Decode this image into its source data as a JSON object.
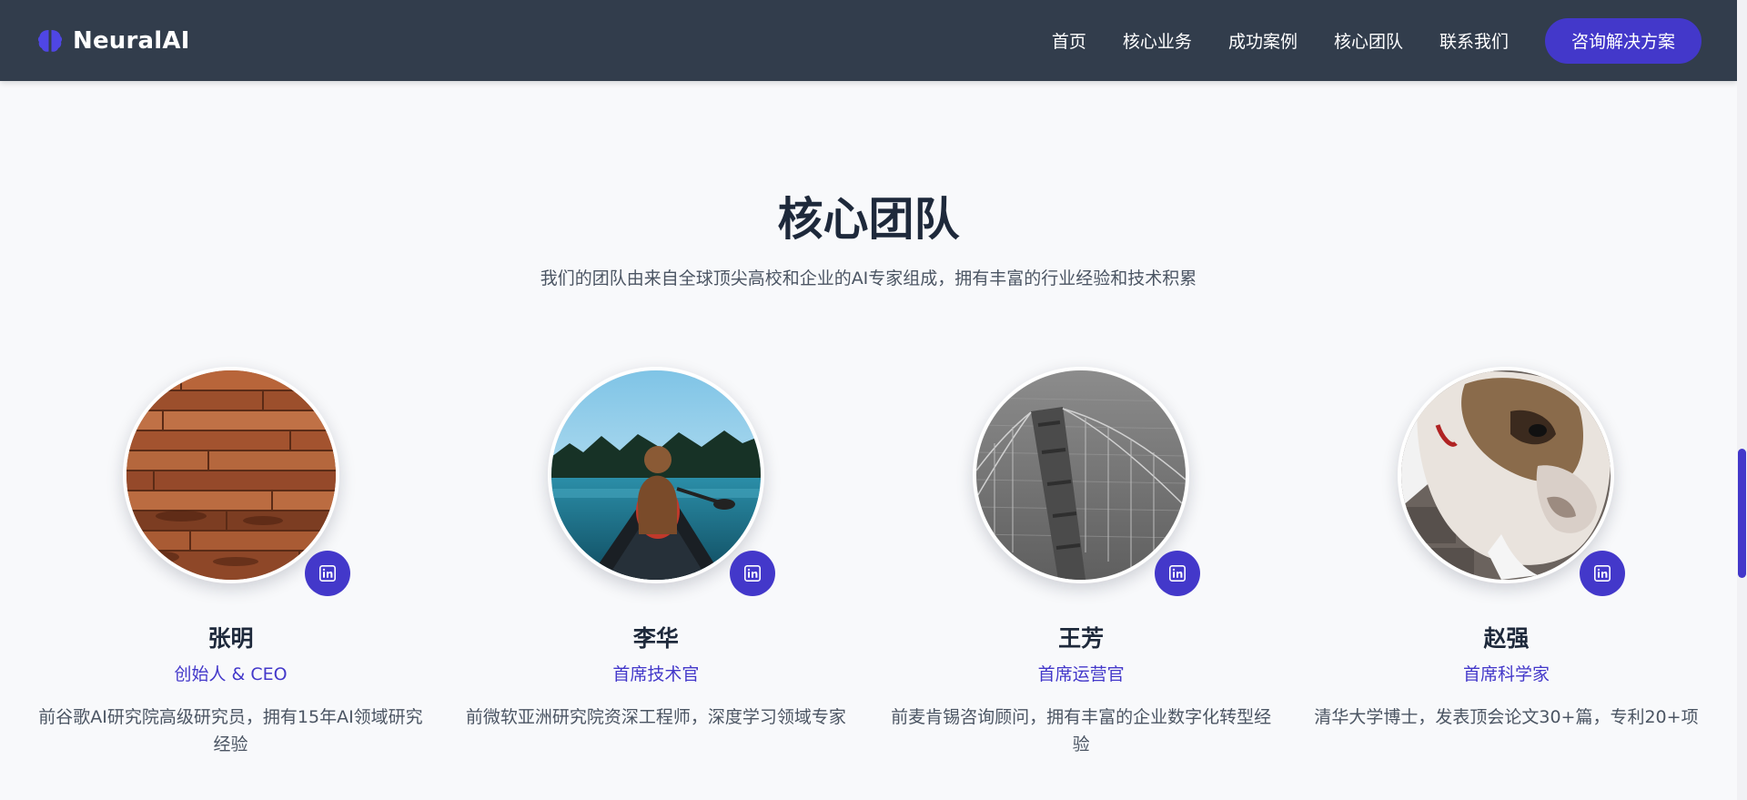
{
  "brand": {
    "name": "NeuralAI",
    "icon": "brain-icon",
    "icon_color": "#4f46e5"
  },
  "nav": {
    "links": [
      "首页",
      "核心业务",
      "成功案例",
      "核心团队",
      "联系我们"
    ],
    "cta_label": "咨询解决方案"
  },
  "colors": {
    "accent": "#4338ca",
    "navbar_bg": "#323d4c",
    "page_bg": "#f8f9fb"
  },
  "team": {
    "title": "核心团队",
    "subtitle": "我们的团队由来自全球顶尖高校和企业的AI专家组成，拥有丰富的行业经验和技术积累",
    "members": [
      {
        "name": "张明",
        "role": "创始人 & CEO",
        "desc": "前谷歌AI研究院高级研究员，拥有15年AI领域研究经验",
        "photo": "wood-planks",
        "social_icon": "linkedin-icon"
      },
      {
        "name": "李华",
        "role": "首席技术官",
        "desc": "前微软亚洲研究院资深工程师，深度学习领域专家",
        "photo": "woman-canoe-lake",
        "social_icon": "linkedin-icon"
      },
      {
        "name": "王芳",
        "role": "首席运营官",
        "desc": "前麦肯锡咨询顾问，拥有丰富的企业数字化转型经验",
        "photo": "bridge-tower-grayscale",
        "social_icon": "linkedin-icon"
      },
      {
        "name": "赵强",
        "role": "首席科学家",
        "desc": "清华大学博士，发表顶会论文30+篇，专利20+项",
        "photo": "bulldog",
        "social_icon": "linkedin-icon"
      }
    ]
  }
}
